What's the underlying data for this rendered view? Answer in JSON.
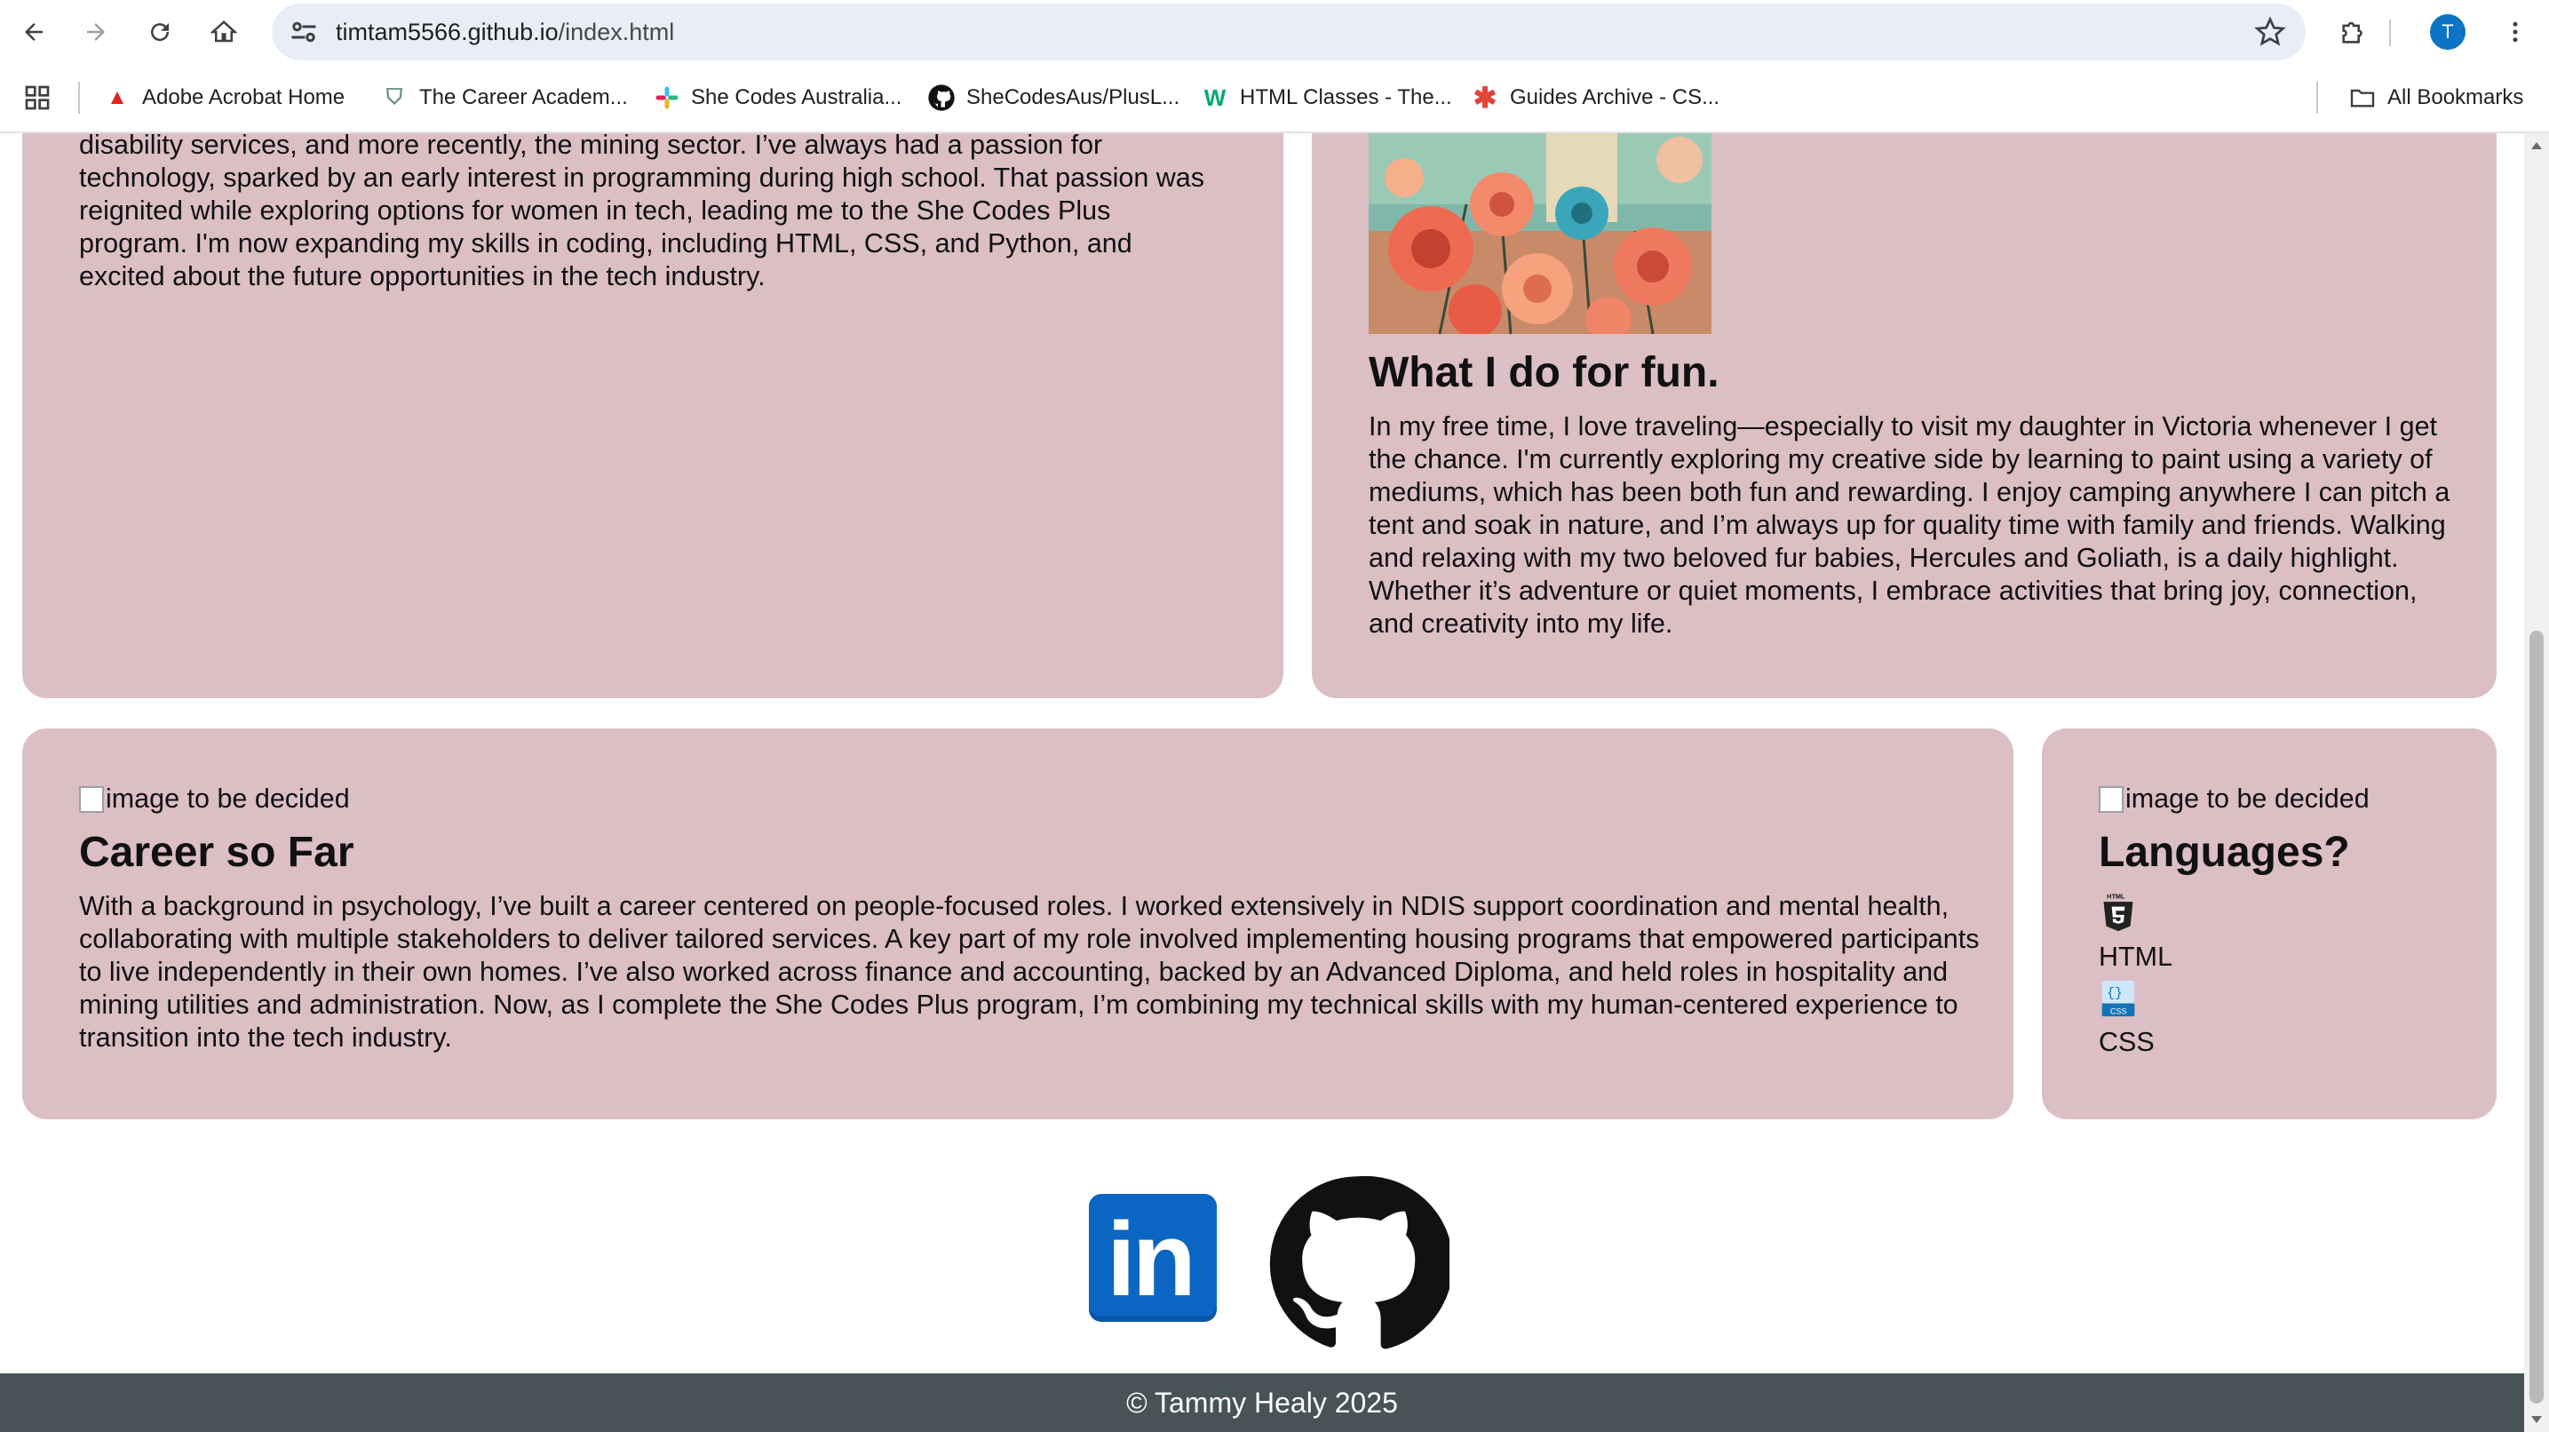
{
  "browser": {
    "url_host": "timtam5566.github.io",
    "url_path": "/index.html",
    "profile_initial": "T",
    "bookmarks": [
      {
        "label": "Adobe Acrobat Home"
      },
      {
        "label": "The Career Academ..."
      },
      {
        "label": "She Codes Australia..."
      },
      {
        "label": "SheCodesAus/PlusL..."
      },
      {
        "label": "HTML Classes - The..."
      },
      {
        "label": "Guides Archive - CS..."
      }
    ],
    "all_bookmarks": "All Bookmarks"
  },
  "about": {
    "paragraph": "my children. My career journey has taken me through a range of industries including hospitality, disability services, and more recently, the mining sector. I’ve always had a passion for technology, sparked by an early interest in programming during high school. That passion was reignited while exploring options for women in tech, leading me to the She Codes Plus program. I'm now expanding my skills in coding, including HTML, CSS, and Python, and excited about the future opportunities in the tech industry."
  },
  "fun": {
    "title": "What I do for fun.",
    "paragraph": "In my free time, I love traveling—especially to visit my daughter in Victoria whenever I get the chance. I'm currently exploring my creative side by learning to paint using a variety of mediums, which has been both fun and rewarding. I enjoy camping anywhere I can pitch a tent and soak in nature, and I’m always up for quality time with family and friends. Walking and relaxing with my two beloved fur babies, Hercules and Goliath, is a daily highlight. Whether it’s adventure or quiet moments, I embrace activities that bring joy, connection, and creativity into my life."
  },
  "career": {
    "image_alt": "image to be decided",
    "title": "Career so Far",
    "paragraph": "With a background in psychology, I’ve built a career centered on people-focused roles. I worked extensively in NDIS support coordination and mental health, collaborating with multiple stakeholders to deliver tailored services. A key part of my role involved implementing housing programs that empowered participants to live independently in their own homes. I’ve also worked across finance and accounting, backed by an Advanced Diploma, and held roles in hospitality and mining utilities and administration. Now, as I complete the She Codes Plus program, I’m combining my technical skills with my human-centered experience to transition into the tech industry."
  },
  "languages": {
    "image_alt": "image to be decided",
    "title": "Languages?",
    "items": [
      {
        "label": "HTML",
        "icon": "html5-icon"
      },
      {
        "label": "CSS",
        "icon": "css-icon"
      }
    ]
  },
  "social": {
    "linkedin_text": "in",
    "icons": [
      "linkedin-icon",
      "github-icon"
    ]
  },
  "footer": {
    "text": "© Tammy Healy 2025"
  },
  "colors": {
    "card_bg": "#dbbfc5",
    "footer_bg": "#475356",
    "linkedin_blue": "#0a66c2"
  }
}
